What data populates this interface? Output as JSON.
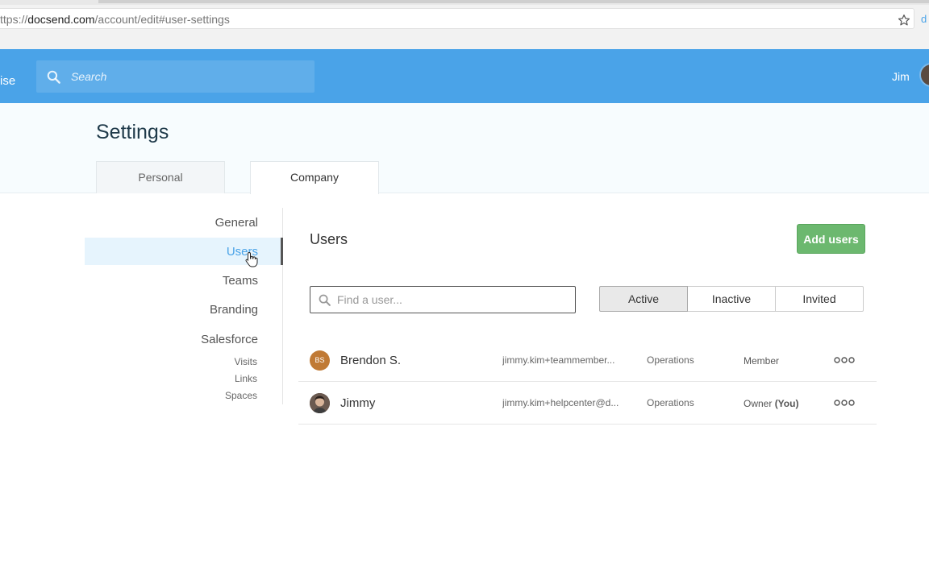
{
  "browser": {
    "url_scheme": "ttps://",
    "url_host": "docsend.com",
    "url_path": "/account/edit#user-settings",
    "extension_glyph": "d"
  },
  "header": {
    "brand_fragment": "ise",
    "search_placeholder": "Search",
    "user_name": "Jim",
    "color": "#4aa3e8"
  },
  "page": {
    "title": "Settings",
    "tabs": [
      {
        "label": "Personal",
        "active": false
      },
      {
        "label": "Company",
        "active": true
      }
    ]
  },
  "sidebar": {
    "items": [
      {
        "label": "General"
      },
      {
        "label": "Users",
        "active": true
      },
      {
        "label": "Teams"
      },
      {
        "label": "Branding"
      },
      {
        "label": "Salesforce"
      }
    ],
    "sub_items": [
      {
        "label": "Visits"
      },
      {
        "label": "Links"
      },
      {
        "label": "Spaces"
      }
    ],
    "active_color": "#4aa3e8"
  },
  "main": {
    "section_title": "Users",
    "add_button_label": "Add users",
    "find_placeholder": "Find a user...",
    "filters": [
      {
        "label": "Active",
        "active": true
      },
      {
        "label": "Inactive",
        "active": false
      },
      {
        "label": "Invited",
        "active": false
      }
    ],
    "users": [
      {
        "initials": "BS",
        "name": "Brendon S.",
        "email": "jimmy.kim+teammember...",
        "team": "Operations",
        "role": "Member",
        "role_suffix": ""
      },
      {
        "initials": "",
        "name": "Jimmy",
        "email": "jimmy.kim+helpcenter@d...",
        "team": "Operations",
        "role": "Owner",
        "role_suffix": "(You)"
      }
    ],
    "accent_green": "#6cb86f"
  }
}
